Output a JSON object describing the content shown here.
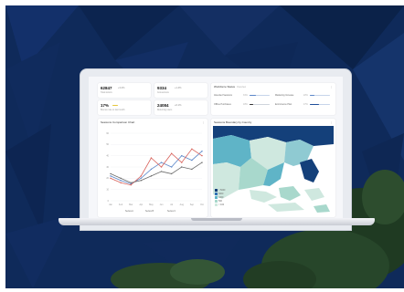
{
  "kpis": [
    {
      "value": "62847",
      "change": "+3.2%",
      "sub": "Total visitors"
    },
    {
      "value": "9334",
      "change": "+1.4%",
      "sub": "Conversions"
    },
    {
      "value": "17%",
      "change": "",
      "sub": "Bounce rate vs last month"
    },
    {
      "value": "24084",
      "change": "+6.1%",
      "sub": "Returning users"
    }
  ],
  "metrics": {
    "title": "Workforce Status",
    "tag": "Overview",
    "rows": [
      {
        "label": "Attended Sessions",
        "value": "31%"
      },
      {
        "label": "Marketing Increase",
        "value": "22%"
      },
      {
        "label": "Offline Purchases",
        "value": "18%"
      },
      {
        "label": "Ecommerce Plan",
        "value": "47%"
      }
    ]
  },
  "line_chart": {
    "title": "Sessions Comparison Chart",
    "legend": [
      "Series A",
      "Series B",
      "Series C"
    ]
  },
  "map": {
    "title": "Sessions Boundary by Country",
    "legend": [
      "> 5000",
      "3000",
      "1000",
      "500",
      "< 100"
    ]
  },
  "chart_data": {
    "type": "line",
    "x": [
      "Jan",
      "Feb",
      "Mar",
      "Apr",
      "May",
      "Jun",
      "Jul",
      "Aug",
      "Sep",
      "Oct"
    ],
    "series": [
      {
        "name": "Series A",
        "values": [
          22,
          18,
          15,
          20,
          28,
          34,
          30,
          40,
          36,
          44
        ]
      },
      {
        "name": "Series B",
        "values": [
          20,
          16,
          14,
          22,
          38,
          30,
          42,
          34,
          46,
          40
        ]
      },
      {
        "name": "Series C",
        "values": [
          24,
          20,
          16,
          18,
          22,
          26,
          24,
          30,
          28,
          34
        ]
      }
    ],
    "ylim": [
      0,
      60
    ],
    "colors": [
      "#5b87c9",
      "#d8625b",
      "#6a6a6a"
    ]
  },
  "colors": {
    "background": "#0f2a5a",
    "map_sea": "#ffffff",
    "map_light": "#cfe8df",
    "map_mid": "#5fb4c7",
    "map_dark": "#14407a"
  }
}
